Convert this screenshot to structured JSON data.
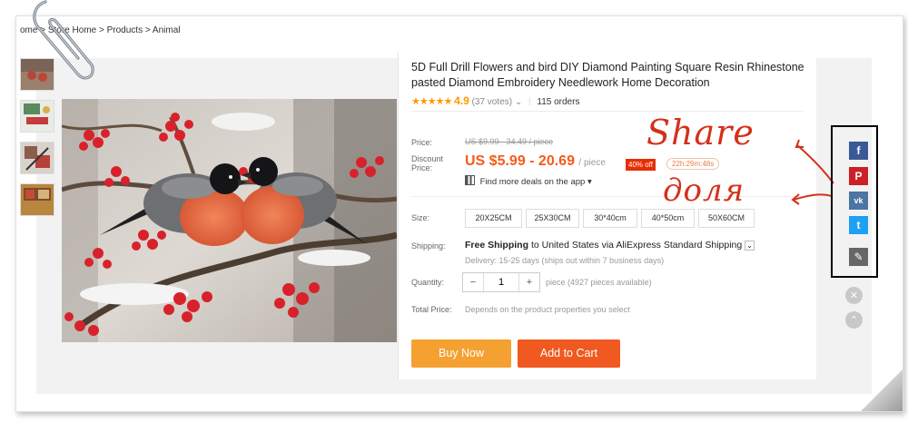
{
  "breadcrumb": "ome > Store Home > Products > Animal",
  "product": {
    "title": "5D Full Drill Flowers and bird DIY Diamond Painting Square Resin Rhinestone pasted Diamond Embroidery Needlework Home Decoration",
    "stars": "★★★★★",
    "rating": "4.9",
    "votes": "(37 votes)",
    "votes_caret": "⌄",
    "orders": "115 orders"
  },
  "price": {
    "price_label": "Price:",
    "original": "US $9.99 - 34.49 / piece",
    "discount_label": "Discount Price:",
    "current": "US $5.99 - 20.69",
    "unit": "/ piece",
    "off_badge": "40% off",
    "timer": "22h:29m:48s",
    "deals": "Find more deals on the app",
    "deals_caret": "▾"
  },
  "size": {
    "label": "Size:",
    "options": [
      "20X25CM",
      "25X30CM",
      "30*40cm",
      "40*50cm",
      "50X60CM"
    ]
  },
  "shipping": {
    "label": "Shipping:",
    "free": "Free Shipping",
    "to": "to United States via AliExpress Standard Shipping",
    "caret": "⌄",
    "delivery": "Delivery: 15-25 days (ships out within 7 business days)"
  },
  "quantity": {
    "label": "Quantity:",
    "minus": "−",
    "value": "1",
    "plus": "+",
    "note": "piece (4927 pieces available)"
  },
  "total": {
    "label": "Total Price:",
    "note": "Depends on the product properties you select"
  },
  "buttons": {
    "buy_now": "Buy Now",
    "add_to_cart": "Add to Cart"
  },
  "annotations": {
    "share": "Share",
    "dolya": "доля"
  },
  "social": {
    "facebook": "f",
    "pinterest": "P",
    "vk": "vk",
    "twitter": "t",
    "edit": "✎",
    "close": "✕",
    "up": "⌃"
  },
  "colors": {
    "price_orange": "#f55b1a",
    "buy_now": "#f5a131",
    "add_to_cart": "#f0591f",
    "facebook": "#3b5998",
    "pinterest": "#cb2027",
    "vk": "#4c75a3",
    "twitter": "#1da1f2",
    "annotation_red": "#d4301a"
  }
}
